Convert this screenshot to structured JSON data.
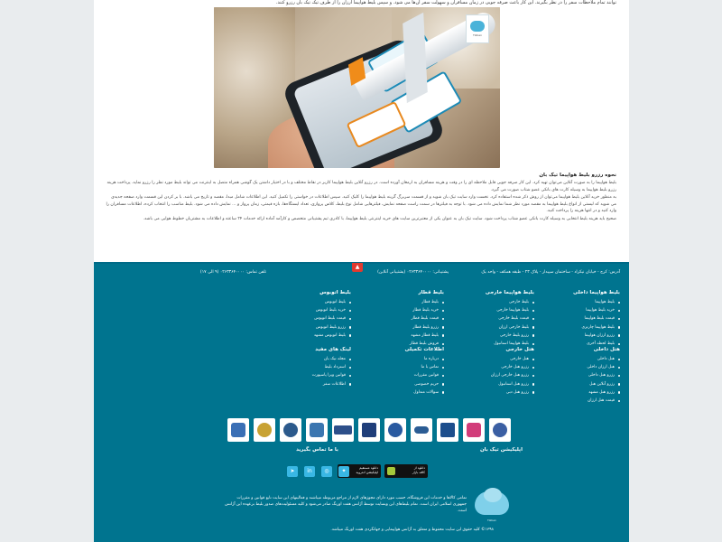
{
  "article": {
    "top_text": "توانند تمام ملاحظات سفر را در نظر بگیرند. این کار باعث صرفه جویی در زمان مسافران و سهولت سفر آن‌ها می شود. و سپس بلیط هواپیما ارزان را از طرف تیک تیک بان رزرو کنند.",
    "title": "نحوه رزرو بلیط هواپیما تیک بان",
    "paragraphs": [
      "بلیط هواپیما را به صورت آنلاین می‌توان تهیه کرد. این کار صرفه جویی قابل ملاحظه ای را در وقت و هزینه مسافران به ارمغان آورده است. در رزرو آنلاین بلیط هواپیما کاربر در نقاط مختلف و با در اختیار داشتن یک گوشی همراه متصل به اینترنت می تواند بلیط مورد نظر را رزرو نماید. پرداخت هزینه رزرو بلیط هواپیما به وسیله کارت های بانکی عضو شتاب صورت می گیرد.",
      "به منظور خرید آنلاین بلیط هواپیما می‌توان از روش ذکر شده استفاده کرد. نخست وارد سایت تیک بان شوید و از قسمت سربرگ گزینه بلیط هواپیما را کلیک کنید. سپس اطلاعات در خواستی را تکمیل کنید. این اطلاعات شامل مبدا، مقصد و تاریخ می باشد. با بر کردن این قسمت وارد صفحه جدیدی می شوید که لیستی از انواع بلیط هواپیما به مقصد مورد نظر شما نمایش داده می شود. با توجه به فیلترها در سمت راست صفحه نمایش، فیلترهایی شامل نوع بلیط، کلاس پروازی، تعداد ایستگاه‌ها، بازه قیمتی، زمان پرواز و ... نمایش داده می شود. بلیط مناسب را انتخاب کرده، اطلاعات مسافران را وارد کنید و در انتها هزینه را پرداخت کنید.",
      "صحیح باید هزینه بلیط انتخابی به وسیله کارت بانکی عضو شتاب پرداخت شود. سایت تیک بان به عنوان یکی از معتبرترین سایت های خرید اینترنتی بلیط هواپیما، با کادری ثبم پشتیبانی متخصص و کارآمد آماده ارائه خدمات ۲۴ ساعته و اطلاعات به مشتریان خطوط هوایی می باشد."
    ]
  },
  "contact": {
    "address": "آدرس: کرج - خیابان نیکزاد - ساختمان سپیدار - پلاک ۲۳ - طبقه همکف - واحد یک",
    "support": "پشتیبانی: ۰۲۶۳۳۶۴۰۰۰۰ (پشتیبانی آنلاین)",
    "phone": "تلفن تماس: ۰۲۶۳۳۶۴۰۰۰۰ (۹ الی ۱۷)"
  },
  "columns": [
    {
      "title": "بلیط هواپیما داخلی",
      "items": [
        "بلیط هواپیما",
        "خرید بلیط هواپیما",
        "قیمت بلیط هواپیما",
        "بلیط هواپیما چارتری",
        "رزرو ارزان هواپیما",
        "بلیط لحظه آخری"
      ]
    },
    {
      "title": "بلیط هواپیما خارجی",
      "items": [
        "بلیط خارجی",
        "بلیط هواپیما خارجی",
        "قیمت بلیط خارجی",
        "بلیط خارجی ارزان",
        "رزرو بلیط خارجی",
        "بلیط هواپیما استانبول"
      ]
    },
    {
      "title": "بلیط قطار",
      "items": [
        "بلیط قطار",
        "خرید بلیط قطار",
        "قیمت بلیط قطار",
        "رزرو بلیط قطار",
        "بلیط قطار مشهد",
        "فروش بلیط قطار"
      ]
    },
    {
      "title": "بلیط اتوبوس",
      "items": [
        "بلیط اتوبوس",
        "خرید بلیط اتوبوس",
        "قیمت بلیط اتوبوس",
        "رزرو بلیط اتوبوس",
        "بلیط اتوبوس مشهد"
      ]
    },
    {
      "title": "هتل داخلی",
      "items": [
        "هتل داخلی",
        "هتل ارزان داخلی",
        "رزرو هتل داخلی",
        "رزرو آنلاین هتل",
        "رزرو هتل مشهد",
        "قیمت هتل ارزان"
      ]
    },
    {
      "title": "هتل خارجی",
      "items": [
        "هتل خارجی",
        "رزرو هتل خارجی",
        "رزرو هتل خارجی ارزان",
        "رزرو هتل استانبول",
        "رزرو هتل دبی"
      ]
    },
    {
      "title": "اطلاعات تکمیلی",
      "items": [
        "درباره ما",
        "تماس با ما",
        "قوانین مقررات",
        "حریم خصوصی",
        "سوالات متداول"
      ]
    },
    {
      "title": "لینک های مفید",
      "items": [
        "مجله تیک بان",
        "استرداد بلیط",
        "قوانین ویزا پاسپورت",
        "اطلاعات سفر"
      ]
    }
  ],
  "badges": [
    {
      "name": "enamad-badge",
      "color": "#3a6fb5"
    },
    {
      "name": "samandehi-badge",
      "color": "#c8a233"
    },
    {
      "name": "airline-association-badge",
      "color": "#2c5a8c"
    },
    {
      "name": "passenger-rights-badge",
      "color": "#3b76b0"
    },
    {
      "name": "itoa-badge",
      "color": "#2d4f8a"
    },
    {
      "name": "iata-badge",
      "color": "#1f3e7a"
    },
    {
      "name": "cao-badge",
      "color": "#2a5aa0"
    },
    {
      "name": "airline-badge",
      "color": "#2b5c94"
    },
    {
      "name": "tourism-badge",
      "color": "#1d4e8c"
    },
    {
      "name": "ecommerce-badge",
      "color": "#d23d7a"
    },
    {
      "name": "ticket-association-badge",
      "color": "#3b5fa3"
    }
  ],
  "apps": {
    "title": "اپلیکیشن تیک بان",
    "bazaar_label": "دانلود از",
    "bazaar_name": "کافه بازار",
    "android_label": "دانلود مستقیم",
    "android_name": "اپلیکیشن اندروید"
  },
  "social": {
    "title": "با ما تماس بگیرید",
    "icons": [
      "twitter-icon",
      "instagram-icon",
      "linkedin-icon",
      "telegram-icon"
    ]
  },
  "footer": {
    "logo_text": "Tikban",
    "description": "تمامی کالاها و خدمات این فروشگاه، حسب مورد دارای مجوزهای لازم از مراجع مربوطه میباشند و فعالیتهای این سایت تابع قوانین و مقررات جمهوری اسلامی ایران است. تمام بلیط‌های این وبسایت توسط آژانس هفت اورنگ صادر می‌شود و کلیه مسئولیت‌های صدور بلیط برعهده این آژانس است.",
    "copyright": "۱۳۹۸© کلیه حقوق این سایت محفوظ و متعلق به آژانس هواپیمایی و جهانگردی هفت اورنگ میباشد."
  }
}
